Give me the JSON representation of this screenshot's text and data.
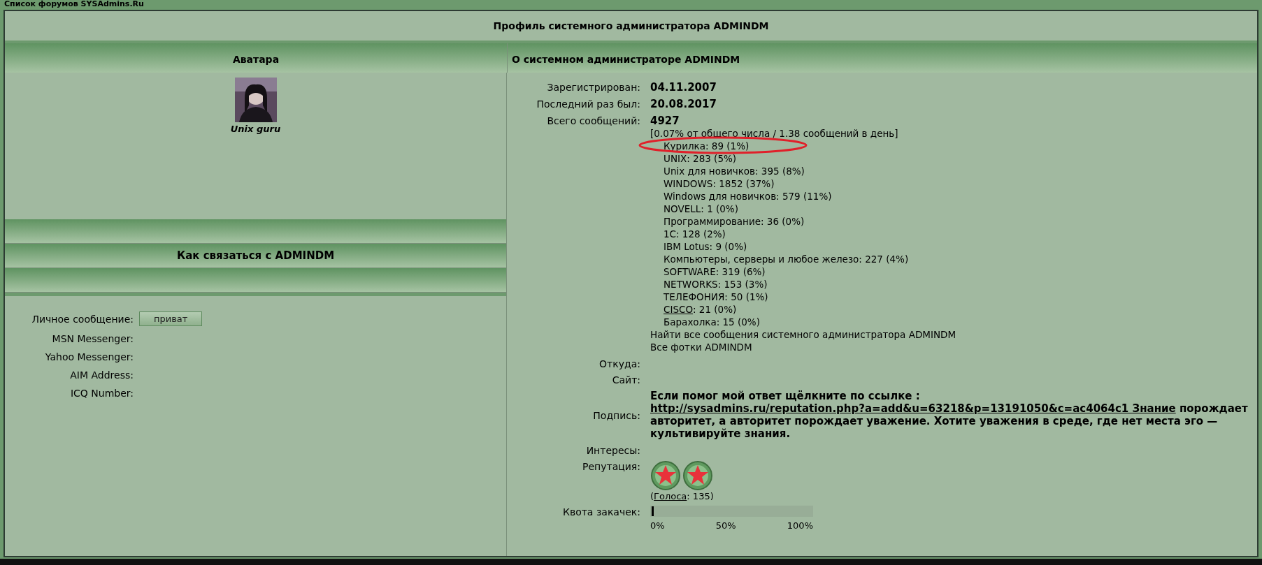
{
  "top_bar": {
    "title": "Список форумов SYSAdmins.Ru"
  },
  "profile": {
    "title": "Профиль системного администратора ADMINDM",
    "left_header": "Аватара",
    "right_header": "О системном администраторе ADMINDM"
  },
  "avatar": {
    "kind": "picture",
    "rank": "Unix guru"
  },
  "contact": {
    "title": "Как связаться с ADMINDM",
    "pm_label": "Личное сообщение:",
    "pm_button": "приват",
    "fields": [
      {
        "label": "MSN Messenger:"
      },
      {
        "label": "Yahoo Messenger:"
      },
      {
        "label": "AIM Address:"
      },
      {
        "label": "ICQ Number:"
      }
    ]
  },
  "about": {
    "rows": [
      {
        "label": "Зарегистрирован:",
        "value": "04.11.2007"
      },
      {
        "label": "Последний раз был:",
        "value": "20.08.2017"
      }
    ],
    "posts_label": "Всего сообщений:",
    "posts_value": "4927",
    "posts_stats": "[0.07% от общего числа / 1.38 сообщений в день]",
    "forums": [
      {
        "name": "Курилка",
        "stat": ": 89 (1%)",
        "link": false,
        "circled": true
      },
      {
        "name": "UNIX",
        "stat": ": 283 (5%)",
        "link": false,
        "circled": false
      },
      {
        "name": "Unix для новичков",
        "stat": ": 395 (8%)",
        "link": false,
        "circled": false
      },
      {
        "name": "WINDOWS",
        "stat": ": 1852 (37%)",
        "link": false,
        "circled": false
      },
      {
        "name": "Windows для новичков",
        "stat": ": 579 (11%)",
        "link": false,
        "circled": false
      },
      {
        "name": "NOVELL",
        "stat": ": 1 (0%)",
        "link": false,
        "circled": false
      },
      {
        "name": "Программирование",
        "stat": ": 36 (0%)",
        "link": false,
        "circled": false
      },
      {
        "name": "1C",
        "stat": ": 128 (2%)",
        "link": false,
        "circled": false
      },
      {
        "name": "IBM Lotus",
        "stat": ": 9 (0%)",
        "link": false,
        "circled": false
      },
      {
        "name": "Компьютеры, серверы и любое железо",
        "stat": ": 227 (4%)",
        "link": false,
        "circled": false
      },
      {
        "name": "SOFTWARE",
        "stat": ": 319 (6%)",
        "link": false,
        "circled": false
      },
      {
        "name": "NETWORKS",
        "stat": ": 153 (3%)",
        "link": false,
        "circled": false
      },
      {
        "name": "ТЕЛЕФОНИЯ",
        "stat": ": 50 (1%)",
        "link": false,
        "circled": false
      },
      {
        "name": "CISCO",
        "stat": ": 21 (0%)",
        "link": true,
        "circled": false
      },
      {
        "name": "Барахолка",
        "stat": ": 15 (0%)",
        "link": false,
        "circled": false
      }
    ],
    "find_posts": "Найти все сообщения системного администратора ADMINDM",
    "all_photos": "Все фотки ADMINDM",
    "from_label": "Откуда:",
    "site_label": "Сайт:",
    "signature_label": "Подпись:",
    "signature_before": "Если помог мой ответ щёлкните по ссылке :",
    "signature_link": "http://sysadmins.ru/reputation.php?a=add&u=63218&p=13191050&c=ac4064c1 Знание",
    "signature_after": "порождает авторитет, а авторитет порождает уважение. Хотите уважения в среде, где нет места эго — культивируйте знания.",
    "interests_label": "Интересы:",
    "reputation_label": "Репутация:",
    "reputation": {
      "medals": [
        {
          "kind": "star"
        },
        {
          "kind": "star"
        }
      ],
      "votes_link": "Голоса",
      "votes_count": ": 135)",
      "open": "("
    },
    "quota_label": "Квота закачек:",
    "quota": {
      "level": 0.01,
      "ticks": [
        "0%",
        "50%",
        "100%"
      ]
    }
  }
}
